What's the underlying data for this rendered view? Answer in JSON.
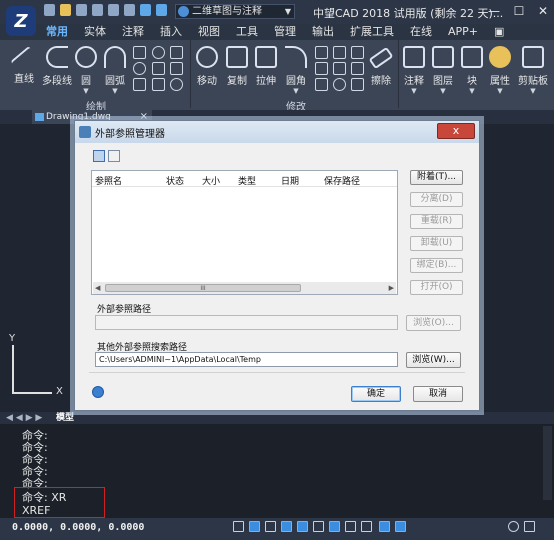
{
  "app": {
    "logo_text": "Z",
    "title": "中望CAD 2018 试用版 (剩余 22 天)...",
    "workspace": "二维草图与注释"
  },
  "menu_tabs": [
    "常用",
    "实体",
    "注释",
    "插入",
    "视图",
    "工具",
    "管理",
    "输出",
    "扩展工具",
    "在线",
    "APP+"
  ],
  "ribbon": {
    "draw_tools": [
      "直线",
      "多段线",
      "圆",
      "圆弧"
    ],
    "modify_tools": [
      "移动",
      "复制",
      "拉伸",
      "圆角"
    ],
    "erase_label": "擦除",
    "right_tools": [
      "注释",
      "图层",
      "块",
      "属性",
      "剪贴板"
    ],
    "group_draw": "绘制",
    "group_modify": "修改"
  },
  "document_tab": {
    "name": "Drawing1.dwg",
    "close": "×"
  },
  "layout_tabs": {
    "model": "模型"
  },
  "ucs": {
    "x": "X",
    "y": "Y"
  },
  "dialog": {
    "title": "外部参照管理器",
    "close": "x",
    "columns": [
      "参照名",
      "状态",
      "大小",
      "类型",
      "日期",
      "保存路径"
    ],
    "scroll_thumb": "III",
    "buttons": [
      "附着(T)...",
      "分离(D)",
      "重载(R)",
      "卸载(U)",
      "绑定(B)...",
      "打开(O)"
    ],
    "found_path_label": "外部参照路径",
    "found_path_value": "",
    "browse1": "浏览(O)...",
    "search_path_label": "其他外部参照搜索路径",
    "search_path_value": "C:\\Users\\ADMINI~1\\AppData\\Local\\Temp",
    "browse2": "浏览(W)...",
    "ok": "确定",
    "cancel": "取消"
  },
  "command": {
    "history": [
      "命令:",
      "命令:",
      "命令:",
      "命令:",
      "命令:",
      "命令: XR"
    ],
    "current": "XREF"
  },
  "status": {
    "coords": "0.0000, 0.0000, 0.0000"
  }
}
